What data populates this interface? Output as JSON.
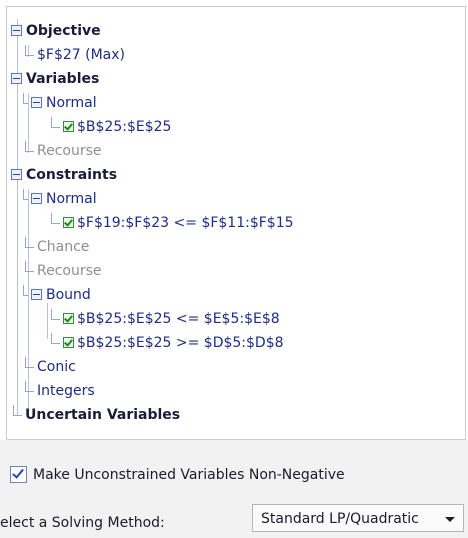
{
  "tree": {
    "objective": {
      "label": "Objective",
      "cell": "$F$27 (Max)"
    },
    "variables": {
      "label": "Variables",
      "normal": {
        "label": "Normal",
        "items": [
          "$B$25:$E$25"
        ]
      },
      "recourse": "Recourse"
    },
    "constraints": {
      "label": "Constraints",
      "normal": {
        "label": "Normal",
        "items": [
          "$F$19:$F$23 <= $F$11:$F$15"
        ]
      },
      "chance": "Chance",
      "recourse": "Recourse",
      "bound": {
        "label": "Bound",
        "items": [
          "$B$25:$E$25 <= $E$5:$E$8",
          "$B$25:$E$25 >= $D$5:$D$8"
        ]
      },
      "conic": "Conic",
      "integers": "Integers"
    },
    "uncertain": "Uncertain Variables"
  },
  "options": {
    "nonneg_label": "Make Unconstrained Variables Non-Negative",
    "nonneg_checked": true
  },
  "method": {
    "label": "elect a Solving Method:",
    "selected": "Standard LP/Quadratic"
  },
  "icons": {
    "expander": "minus-box-icon",
    "check": "check-icon"
  }
}
